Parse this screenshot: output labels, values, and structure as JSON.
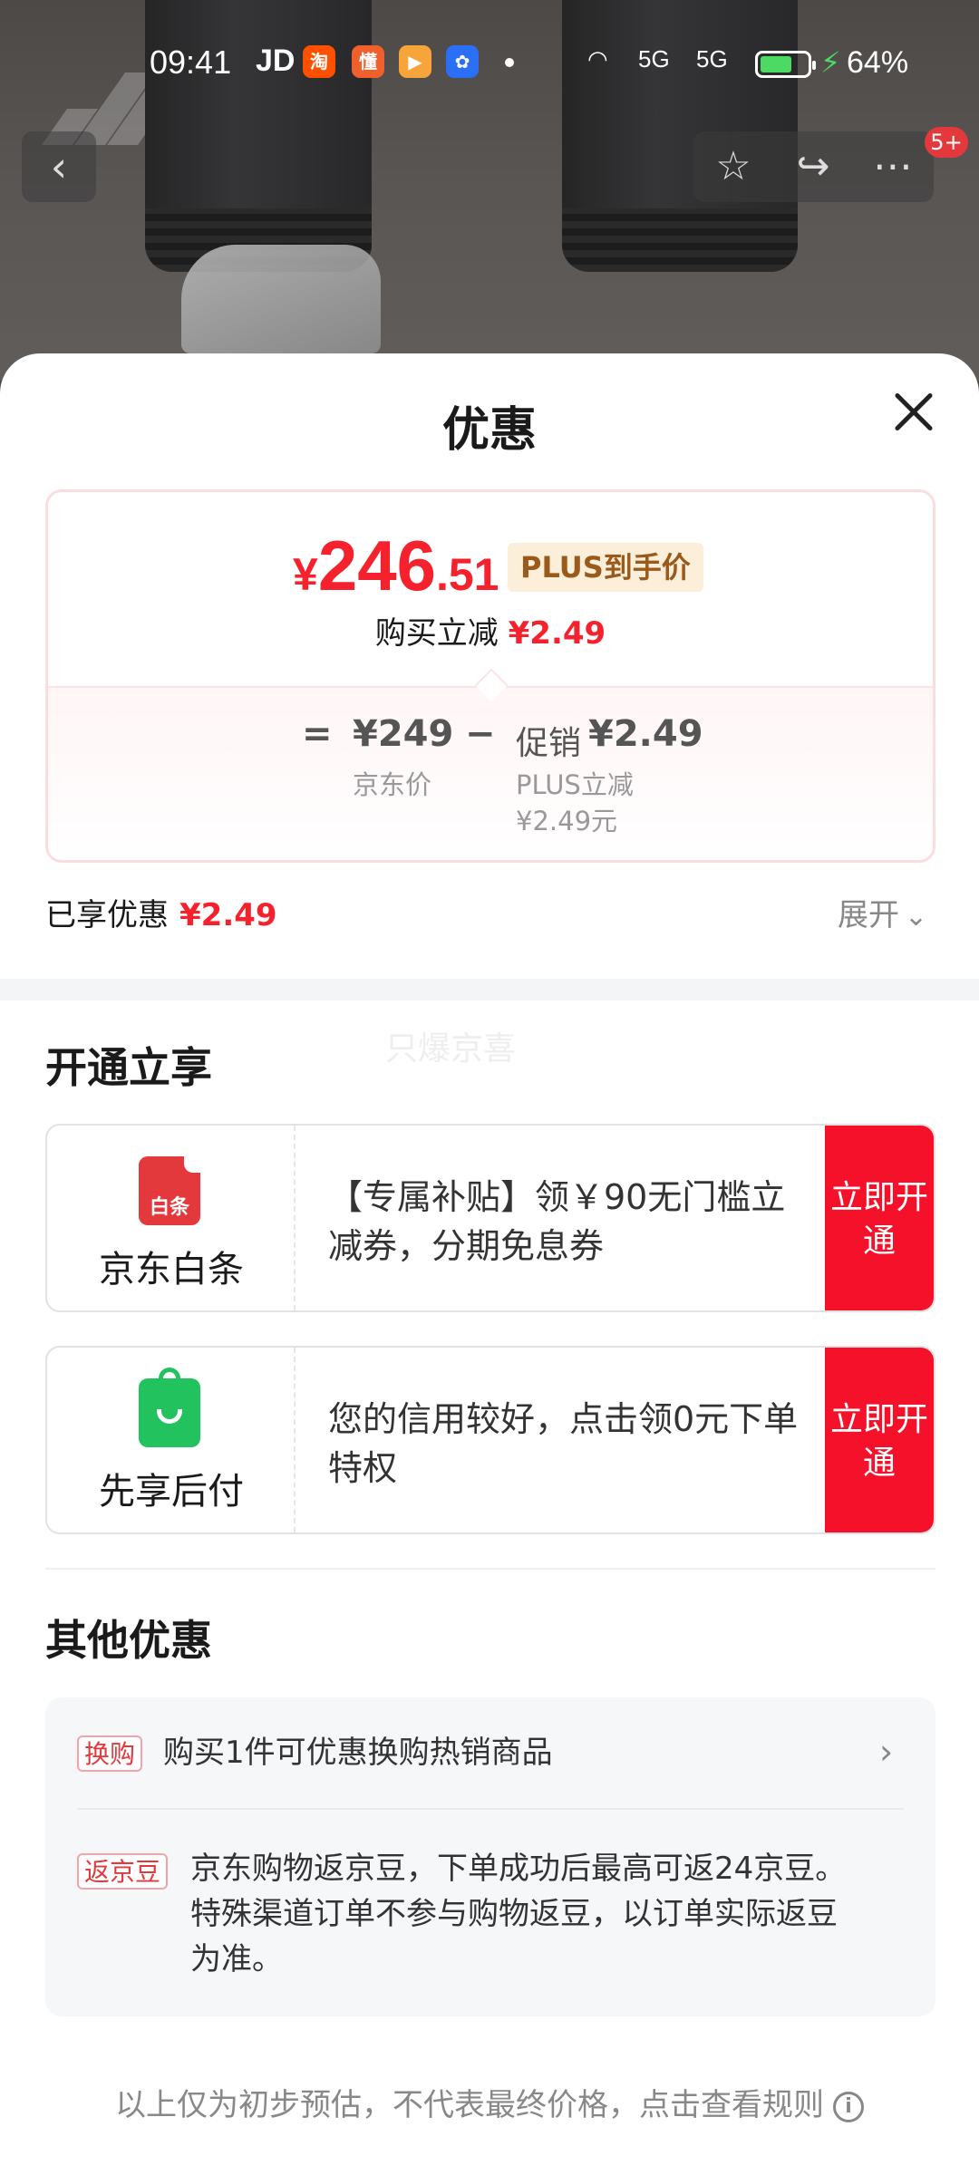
{
  "status_bar": {
    "time": "09:41",
    "carrier": "JD",
    "signal_1": "5G",
    "signal_2": "5G",
    "battery_pct": "64%",
    "colors": {
      "battery_fill": "#4cd964"
    }
  },
  "top_nav": {
    "back_icon": "chevron-left-icon",
    "favorite_icon": "star-icon",
    "share_icon": "share-icon",
    "more_icon": "more-icon",
    "message_badge": "5+"
  },
  "sheet": {
    "title": "优惠",
    "close_icon": "close-icon"
  },
  "price_card": {
    "currency": "¥",
    "price_int": "246",
    "price_dec": ".51",
    "plus_tag": "PLUS到手价",
    "instant_label": "购买立减",
    "instant_value": "¥2.49",
    "equals": "=",
    "jd_price": "¥249",
    "jd_price_label": "京东价",
    "minus": "−",
    "promo_label": "促销",
    "promo_value": "¥2.49",
    "plus_label": "PLUS立减",
    "plus_value": "¥2.49元",
    "colors": {
      "price": "#f5222d",
      "plus_tag_bg": "#fcefd9",
      "plus_tag_text": "#9a5a1c"
    }
  },
  "summary": {
    "enjoyed_label": "已享优惠",
    "enjoyed_value": "¥2.49",
    "expand_label": "展开"
  },
  "open_section": {
    "title": "开通立享",
    "watermark": "只爆京喜",
    "offers": [
      {
        "logo_text": "白条",
        "name": "京东白条",
        "desc": "【专属补贴】领￥90无门槛立减券，分期免息券",
        "button": "立即开通",
        "logo_color": "#e4393c"
      },
      {
        "name": "先享后付",
        "desc": "您的信用较好，点击领0元下单特权",
        "button": "立即开通",
        "logo_color": "#22c35e"
      }
    ],
    "colors": {
      "button": "#f5112a"
    }
  },
  "other_section": {
    "title": "其他优惠",
    "items": [
      {
        "tag": "换购",
        "text": "购买1件可优惠换购热销商品"
      },
      {
        "tag": "返京豆",
        "text": "京东购物返京豆，下单成功后最高可返24京豆。特殊渠道订单不参与购物返豆，以订单实际返豆为准。"
      }
    ]
  },
  "footer": {
    "text": "以上仅为初步预估，不代表最终价格，点击查看规则",
    "icon": "info-icon"
  }
}
